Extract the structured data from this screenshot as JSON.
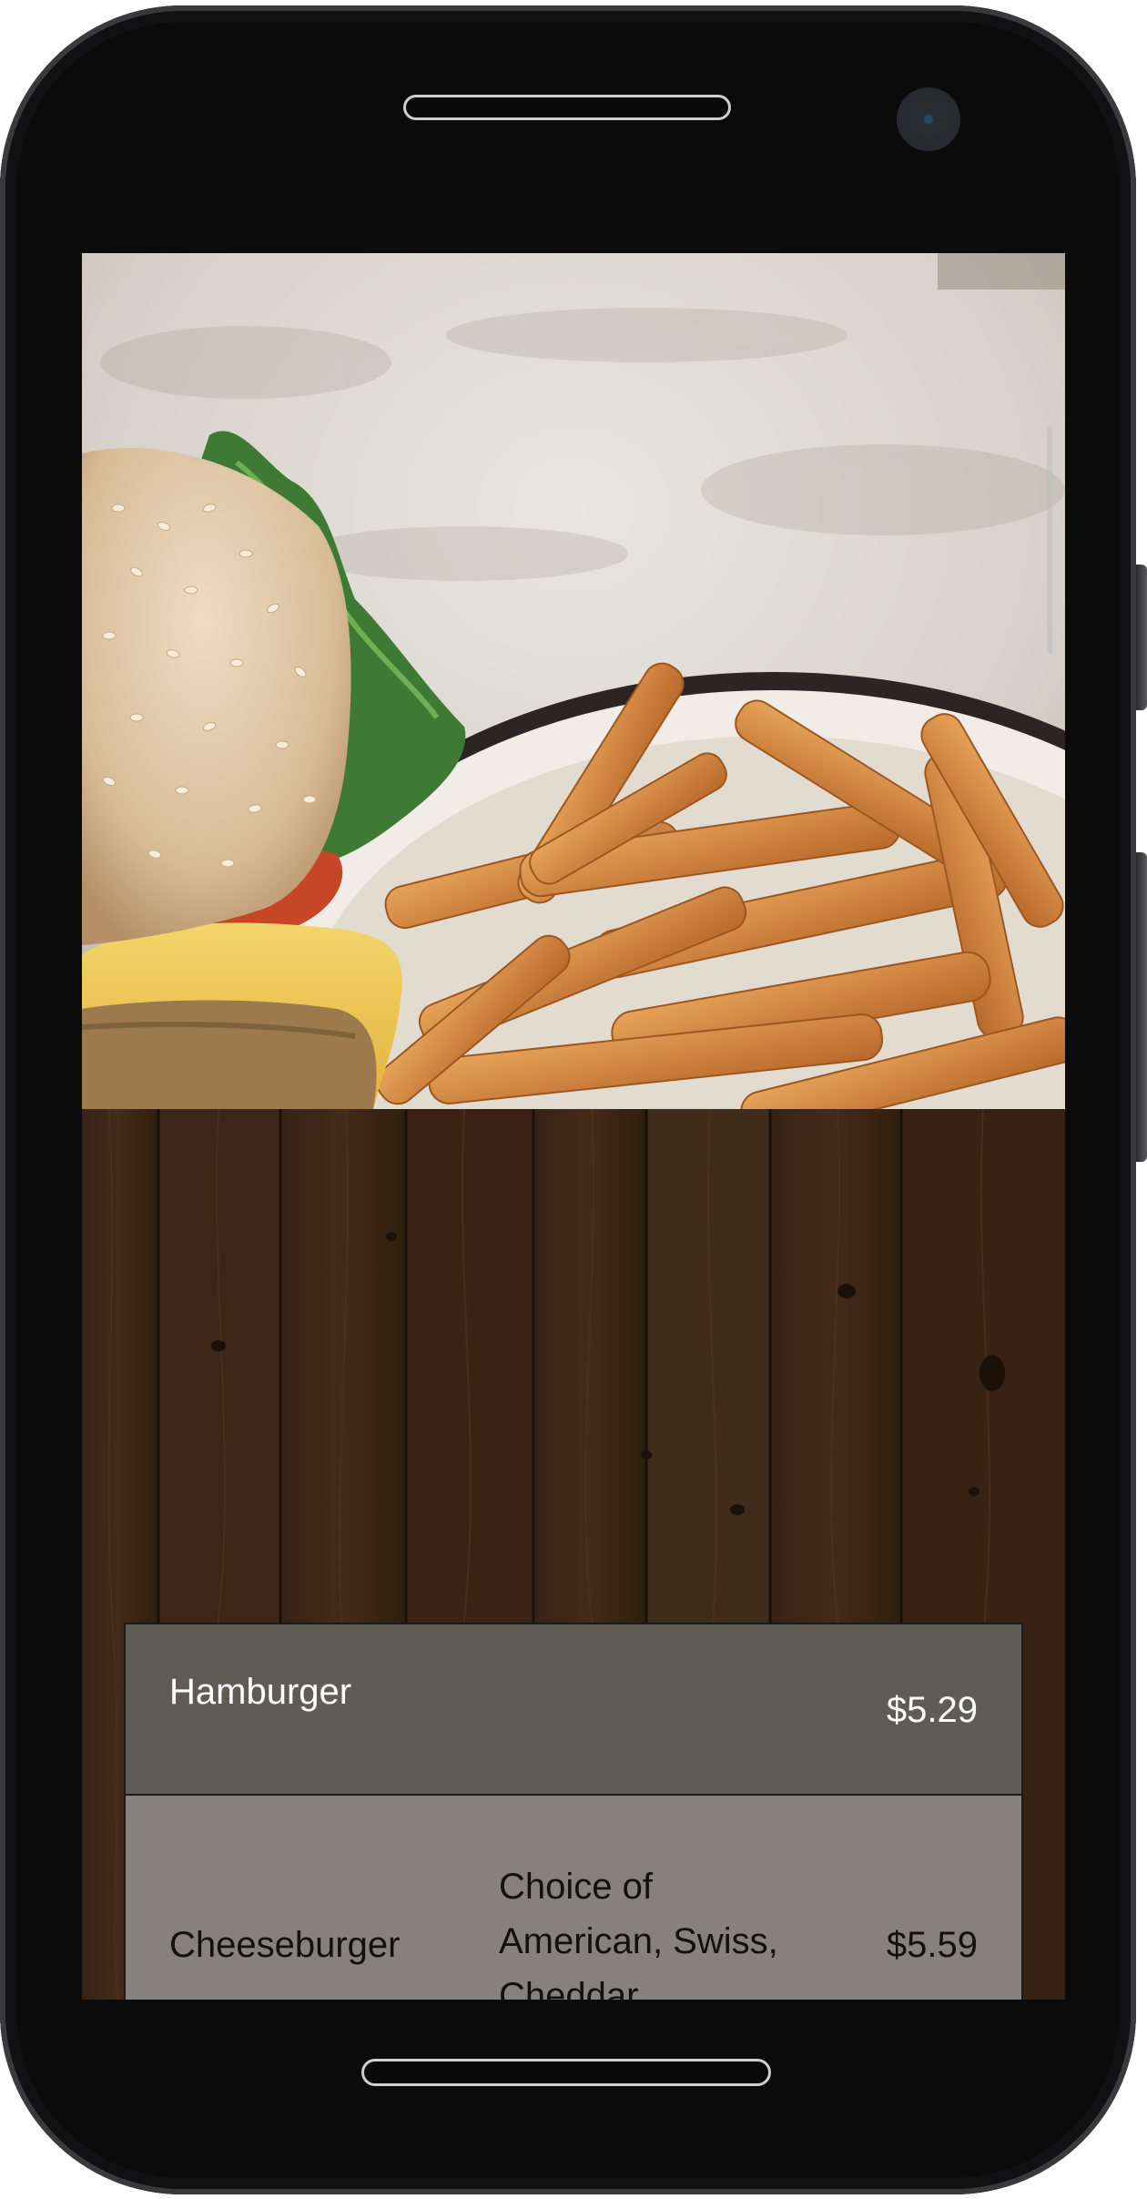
{
  "hero": {
    "image_description_icon": "burger-and-fries-photo"
  },
  "menu": {
    "items": [
      {
        "name": "Hamburger",
        "price": "$5.29",
        "description": ""
      },
      {
        "name": "Cheeseburger",
        "price": "$5.59",
        "description": "Choice of American, Swiss, Cheddar,"
      }
    ]
  },
  "colors": {
    "row_dark": "#5f5b57",
    "row_light": "#86817c",
    "wood": "#3a2618"
  }
}
